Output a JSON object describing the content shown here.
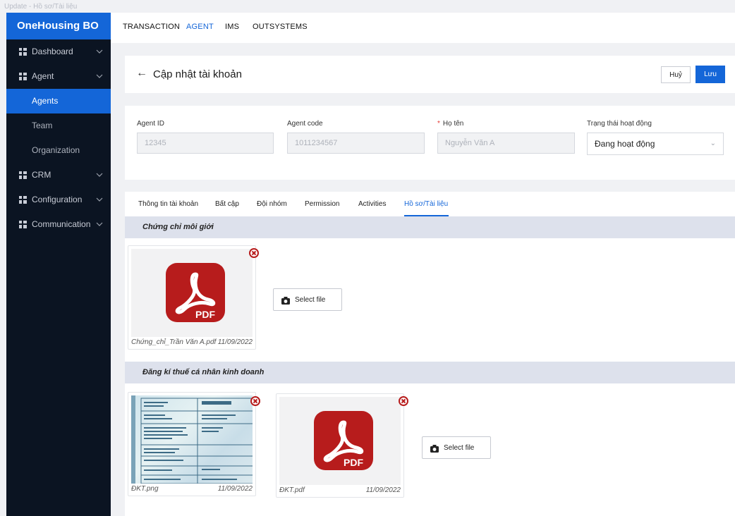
{
  "window": {
    "title": "Update - Hồ sơ/Tài liệu"
  },
  "sidebar": {
    "brand": "OneHousing BO",
    "items": [
      {
        "label": "Dashboard",
        "icon": "grid-icon"
      },
      {
        "label": "Agent",
        "icon": "grid-icon"
      },
      {
        "label": "CRM",
        "icon": "grid-icon"
      },
      {
        "label": "Configuration",
        "icon": "grid-icon"
      },
      {
        "label": "Communication",
        "icon": "grid-icon"
      }
    ],
    "agent_sub": [
      "Agents",
      "Team",
      "Organization"
    ]
  },
  "topnav": {
    "tabs": [
      "TRANSACTION",
      "AGENT",
      "IMS",
      "OUTSYSTEMS"
    ],
    "active": "AGENT"
  },
  "header": {
    "title": "Cập nhật tài khoản",
    "cancel_label": "Huỷ",
    "save_label": "Lưu"
  },
  "form": {
    "agent_id": {
      "label": "Agent ID",
      "value": "12345"
    },
    "agent_code": {
      "label": "Agent code",
      "value": "1011234567"
    },
    "full_name": {
      "label": "Họ tên",
      "value": "Nguyễn Văn A"
    },
    "status": {
      "label": "Trạng thái hoạt động",
      "value": "Đang hoạt động"
    }
  },
  "doc_tabs": [
    "Thông tin tài khoản",
    "Bất cập",
    "Đội nhóm",
    "Permission",
    "Activities",
    "Hồ sơ/Tài liệu"
  ],
  "sections": [
    {
      "title": "Chứng chỉ môi giới",
      "files": [
        {
          "name": "Chứng_chỉ_Trần Văn A.pdf",
          "date": "11/09/2022",
          "kind": "pdf"
        }
      ],
      "select_label": "Select file"
    },
    {
      "title": "Đăng kí thuế cá nhân kinh doanh",
      "files": [
        {
          "name": "ĐKT.png",
          "date": "11/09/2022",
          "kind": "image"
        },
        {
          "name": "ĐKT.pdf",
          "date": "11/09/2022",
          "kind": "pdf"
        }
      ],
      "select_label": "Select file"
    }
  ],
  "pdf_badge": "PDF",
  "colors": {
    "primary": "#1466d8",
    "sidebar": "#0b1422",
    "pdf_red": "#b71c1c",
    "section_bg": "#dde1ec"
  }
}
